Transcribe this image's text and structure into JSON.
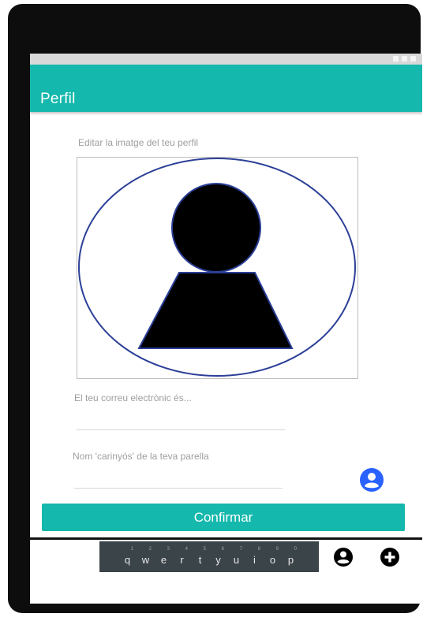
{
  "app": {
    "title": "Perfil"
  },
  "profile_image": {
    "label": "Editar la imatge del teu perfil",
    "icon": "person-silhouette-icon"
  },
  "email": {
    "label": "El teu correu electrònic és...",
    "value": ""
  },
  "nickname": {
    "label": "Nom 'carinyós' de la teva parella",
    "value": "",
    "side_icon": "account-circle-icon"
  },
  "confirm_button": {
    "label": "Confirmar"
  },
  "keyboard": {
    "keys": [
      {
        "char": "q",
        "hint": "1"
      },
      {
        "char": "w",
        "hint": "2"
      },
      {
        "char": "e",
        "hint": "3"
      },
      {
        "char": "r",
        "hint": "4"
      },
      {
        "char": "t",
        "hint": "5"
      },
      {
        "char": "y",
        "hint": "6"
      },
      {
        "char": "u",
        "hint": "7"
      },
      {
        "char": "i",
        "hint": "8"
      },
      {
        "char": "o",
        "hint": "9"
      },
      {
        "char": "p",
        "hint": "0"
      }
    ]
  },
  "bottom_icons": {
    "account": "account-circle-icon",
    "add": "add-circle-icon"
  },
  "colors": {
    "accent": "#14b8ac",
    "icon_blue": "#2962ff",
    "outline_blue": "#2b3f97"
  }
}
